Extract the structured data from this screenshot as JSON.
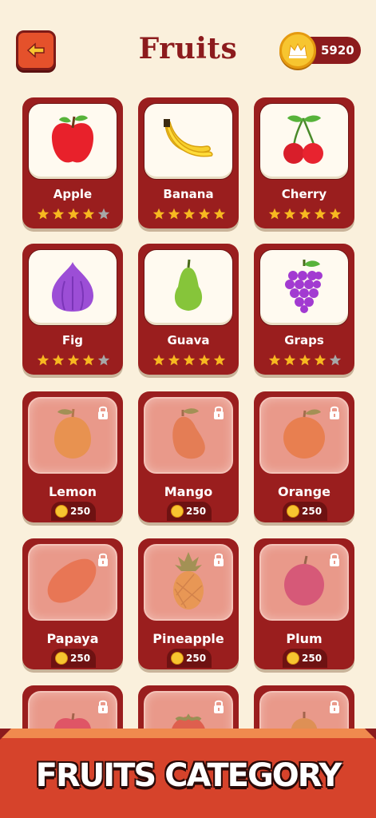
{
  "header": {
    "title": "Fruits",
    "coins": "5920",
    "back_icon": "back-arrow-icon",
    "coin_icon": "crown-coin-icon"
  },
  "colors": {
    "card": "#9a1e1e",
    "accent": "#e5512b",
    "gold": "#f7c530",
    "background": "#faf0dc"
  },
  "fruits": [
    {
      "name": "Apple",
      "locked": false,
      "stars": 4
    },
    {
      "name": "Banana",
      "locked": false,
      "stars": 5
    },
    {
      "name": "Cherry",
      "locked": false,
      "stars": 5
    },
    {
      "name": "Fig",
      "locked": false,
      "stars": 4
    },
    {
      "name": "Guava",
      "locked": false,
      "stars": 5
    },
    {
      "name": "Graps",
      "locked": false,
      "stars": 4
    },
    {
      "name": "Lemon",
      "locked": true,
      "price": "250"
    },
    {
      "name": "Mango",
      "locked": true,
      "price": "250"
    },
    {
      "name": "Orange",
      "locked": true,
      "price": "250"
    },
    {
      "name": "Papaya",
      "locked": true,
      "price": "250"
    },
    {
      "name": "Pineapple",
      "locked": true,
      "price": "250"
    },
    {
      "name": "Plum",
      "locked": true,
      "price": "250"
    },
    {
      "name": "",
      "locked": true
    },
    {
      "name": "",
      "locked": true
    },
    {
      "name": "",
      "locked": true
    }
  ],
  "banner": {
    "text": "FRUITS CATEGORY"
  }
}
